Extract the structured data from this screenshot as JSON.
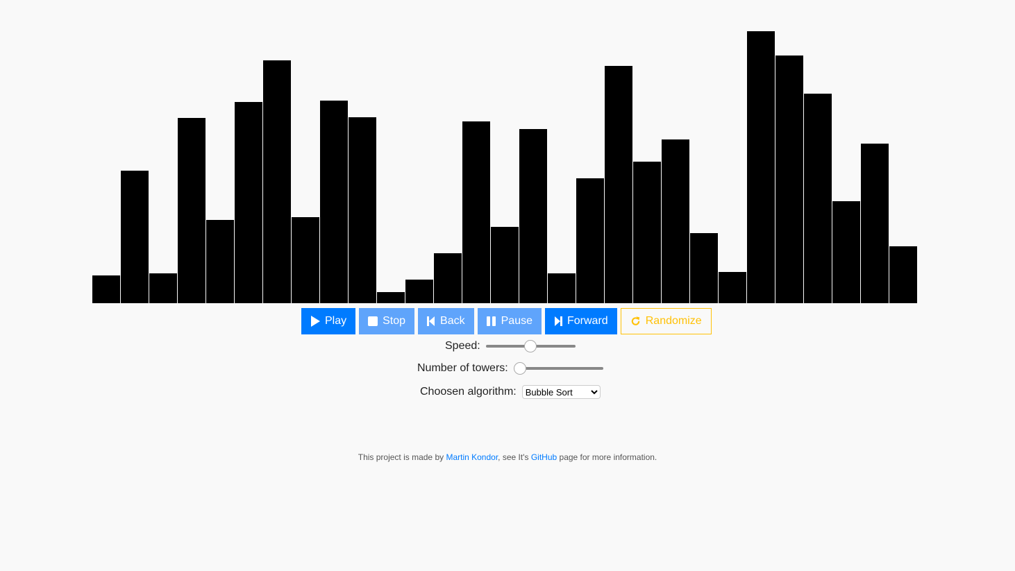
{
  "chart_data": {
    "type": "bar",
    "values": [
      40,
      191,
      43,
      267,
      120,
      290,
      350,
      124,
      292,
      268,
      16,
      34,
      72,
      262,
      110,
      251,
      43,
      180,
      342,
      204,
      236,
      101,
      45,
      392,
      357,
      302,
      147,
      230,
      82
    ],
    "bar_color": "#000000"
  },
  "controls": {
    "play": {
      "label": "Play",
      "icon": "play-icon"
    },
    "stop": {
      "label": "Stop",
      "icon": "stop-icon"
    },
    "back": {
      "label": "Back",
      "icon": "skip-back-icon"
    },
    "pause": {
      "label": "Pause",
      "icon": "pause-icon"
    },
    "forward": {
      "label": "Forward",
      "icon": "skip-forward-icon"
    },
    "randomize": {
      "label": "Randomize",
      "icon": "refresh-icon"
    }
  },
  "speed": {
    "label": "Speed:",
    "value": 50
  },
  "towers": {
    "label": "Number of towers:",
    "value": 0
  },
  "algorithm": {
    "label": "Choosen algorithm:",
    "selected": "Bubble Sort"
  },
  "footer": {
    "pre": "This project is made by ",
    "author": "Martin Kondor",
    "mid": ", see It's ",
    "link": "GitHub",
    "post": " page for more information."
  },
  "colors": {
    "primary": "#007bff",
    "disabled": "#5fa4fb",
    "warning": "#ffc107"
  }
}
